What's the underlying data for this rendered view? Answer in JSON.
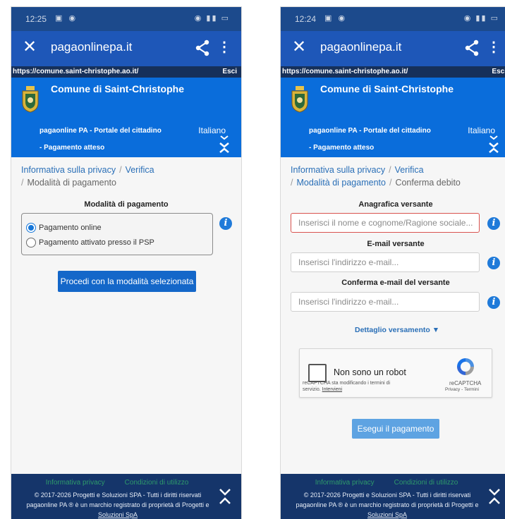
{
  "screens": [
    {
      "status": {
        "time": "12:25"
      },
      "chrome": {
        "domain": "pagaonlinepa.it"
      },
      "url_strip": {
        "url": "https://comune.saint-christophe.ao.it/",
        "exit": "Esci"
      },
      "header": {
        "title": "Comune di Saint-Christophe",
        "subtitle": "pagaonline PA - Portale del cittadino",
        "language": "Italiano",
        "pending": "- Pagamento atteso"
      },
      "breadcrumb": [
        "Informativa sulla privacy",
        "Verifica",
        "Modalità di pagamento"
      ],
      "payment_section": {
        "title": "Modalità di pagamento",
        "options": [
          "Pagamento online",
          "Pagamento attivato presso il PSP"
        ],
        "selected": "Pagamento online"
      },
      "proceed_button": "Procedi con la modalità selezionata",
      "footer": {
        "privacy": "Informativa privacy",
        "terms": "Condizioni di utilizzo",
        "copyright_line1": "© 2017-2026 Progetti e Soluzioni SPA - Tutti i diritti riservati",
        "copyright_line2": "pagaonline PA ® è un marchio registrato di proprietà di Progetti e",
        "copyright_line3": "Soluzioni SpA"
      }
    },
    {
      "status": {
        "time": "12:24"
      },
      "chrome": {
        "domain": "pagaonlinepa.it"
      },
      "url_strip": {
        "url": "https://comune.saint-christophe.ao.it/",
        "exit": "Esci"
      },
      "header": {
        "title": "Comune di Saint-Christophe",
        "subtitle": "pagaonline PA - Portale del cittadino",
        "language": "Italiano",
        "pending": "- Pagamento atteso"
      },
      "breadcrumb": [
        "Informativa sulla privacy",
        "Verifica",
        "Modalità di pagamento",
        "Conferma debito"
      ],
      "form": {
        "payer_label": "Anagrafica versante",
        "payer_placeholder": "Inserisci il nome e cognome/Ragione sociale...",
        "email_label": "E-mail versante",
        "email_placeholder": "Inserisci l'indirizzo e-mail...",
        "confirm_email_label": "Conferma e-mail del versante",
        "confirm_email_placeholder": "Inserisci l'indirizzo e-mail..."
      },
      "details_link": "Dettaglio versamento",
      "captcha": {
        "label": "Non sono un robot",
        "terms_text": "reCAPTCHA sta modificando i termini di servizio.",
        "terms_link": "Intervieni",
        "brand": "reCAPTCHA",
        "privacy_terms": "Privacy - Termini"
      },
      "pay_button": "Esegui il pagamento",
      "footer": {
        "privacy": "Informativa privacy",
        "terms": "Condizioni di utilizzo",
        "copyright_line1": "© 2017-2026 Progetti e Soluzioni SPA - Tutti i diritti riservati",
        "copyright_line2": "pagaonline PA ® è un marchio registrato di proprietà di Progetti e",
        "copyright_line3": "Soluzioni SpA"
      }
    }
  ],
  "icons": {
    "close": "close-icon",
    "share": "share-icon",
    "menu": "more-vert-icon",
    "info": "info-icon",
    "collapse": "collapse-chevron-icon",
    "dropdown": "caret-down-icon",
    "recaptcha": "recaptcha-logo-icon",
    "crest": "municipal-crest-icon"
  },
  "colors": {
    "status_bar": "#1c4a8c",
    "browser_bar": "#1e57b8",
    "url_strip": "#16305a",
    "header": "#0a6ddb",
    "primary_button": "#1467c9",
    "link": "#2a6fb7",
    "footer": "#15356a",
    "error_border": "#d9534f"
  }
}
